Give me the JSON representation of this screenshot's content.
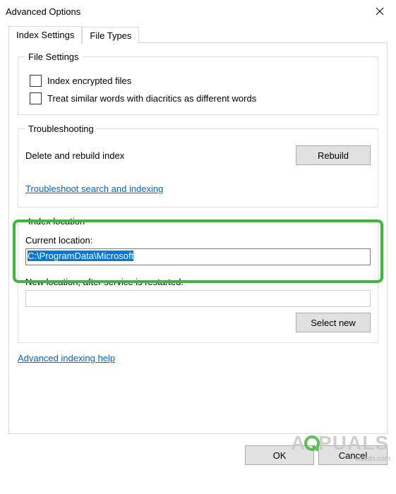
{
  "window": {
    "title": "Advanced Options",
    "close_aria": "Close"
  },
  "tabs": {
    "index_settings": "Index Settings",
    "file_types": "File Types"
  },
  "file_settings": {
    "legend": "File Settings",
    "index_encrypted": "Index encrypted files",
    "treat_similar": "Treat similar words with diacritics as different words"
  },
  "troubleshooting": {
    "legend": "Troubleshooting",
    "delete_rebuild": "Delete and rebuild index",
    "rebuild_btn": "Rebuild",
    "troubleshoot_link": "Troubleshoot search and indexing"
  },
  "index_location": {
    "legend": "Index location",
    "current_label": "Current location:",
    "current_value": "C:\\ProgramData\\Microsoft",
    "new_label": "New location, after service is restarted:",
    "new_value": "",
    "select_new_btn": "Select new"
  },
  "help_link": "Advanced indexing help",
  "buttons": {
    "ok": "OK",
    "cancel": "Cancel"
  },
  "watermark": {
    "before": "A",
    "after": "PUALS",
    "attribution": "wsxdn.com"
  }
}
